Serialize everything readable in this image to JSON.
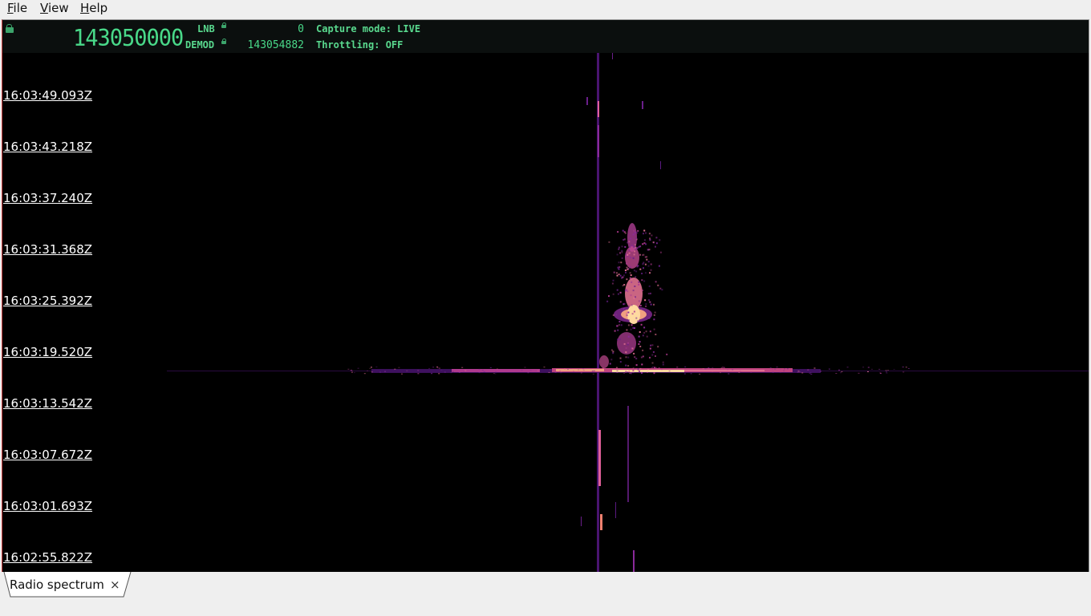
{
  "menu": {
    "file": {
      "mnemonic": "F",
      "rest": "ile"
    },
    "view": {
      "mnemonic": "V",
      "rest": "iew"
    },
    "help": {
      "mnemonic": "H",
      "rest": "elp"
    }
  },
  "readout": {
    "main_frequency": "143050000",
    "lnb_label": "LNB",
    "lnb_value": "0",
    "demod_label": "DEMOD",
    "demod_value": "143054882",
    "capture_mode": "Capture mode: LIVE",
    "throttling": "Throttling: OFF"
  },
  "timestamps": [
    "16:03:49.093Z",
    "16:03:43.218Z",
    "16:03:37.240Z",
    "16:03:31.368Z",
    "16:03:25.392Z",
    "16:03:19.520Z",
    "16:03:13.542Z",
    "16:03:07.672Z",
    "16:03:01.693Z",
    "16:02:55.822Z"
  ],
  "colors": {
    "readout_green": "#59d98e",
    "waterfall_bg": "#000000",
    "signal_hot": "#ffd9a0",
    "signal_mid": "#e0609a",
    "signal_low": "#6a1f8a"
  },
  "tabs": [
    {
      "label": "Radio spectrum",
      "close": "×"
    }
  ]
}
